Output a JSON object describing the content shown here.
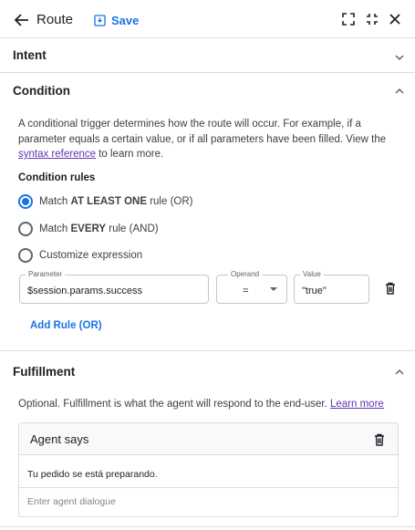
{
  "header": {
    "title": "Route",
    "save_label": "Save"
  },
  "sections": {
    "intent": {
      "title": "Intent"
    },
    "condition": {
      "title": "Condition",
      "desc_line1": "A conditional trigger determines how the route will occur. For example, if a",
      "desc_line2": "parameter equals a certain value, or if all parameters have been filled. View the",
      "desc_link": "syntax reference",
      "desc_after_link": " to learn more.",
      "rules_label": "Condition rules",
      "options": [
        {
          "pre": "Match ",
          "bold": "AT LEAST ONE",
          "post": " rule (OR)",
          "selected": true
        },
        {
          "pre": "Match ",
          "bold": "EVERY",
          "post": " rule (AND)",
          "selected": false
        },
        {
          "pre": "Customize expression",
          "bold": "",
          "post": "",
          "selected": false
        }
      ],
      "rule": {
        "parameter_label": "Parameter",
        "parameter_value": "$session.params.success",
        "operand_label": "Operand",
        "operand_value": "=",
        "value_label": "Value",
        "value_value": "\"true\""
      },
      "add_rule_label": "Add Rule (OR)"
    },
    "fulfillment": {
      "title": "Fulfillment",
      "desc": "Optional. Fulfillment is what the agent will respond to the end-user. ",
      "desc_link": "Learn more",
      "agent_says_title": "Agent says",
      "agent_response": "Tu pedido se está preparando.",
      "input_placeholder": "Enter agent dialogue"
    }
  },
  "colors": {
    "accent": "#1a73e8",
    "link": "#5e35b1",
    "border": "#dadce0"
  }
}
